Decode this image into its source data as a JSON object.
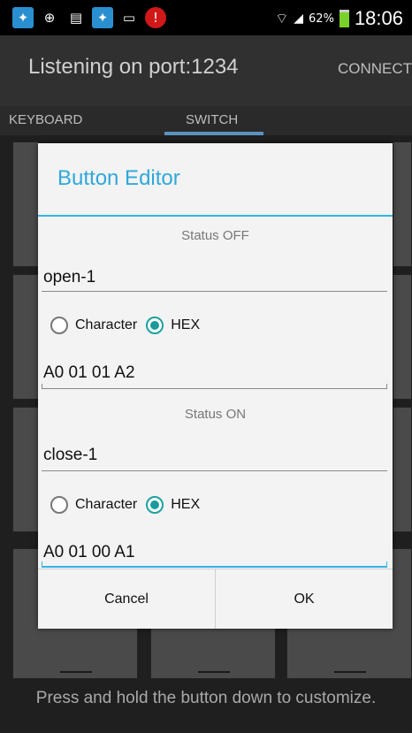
{
  "statusbar": {
    "battery_percent": "62%",
    "time": "18:06",
    "icons": [
      "app-icon",
      "signal-swap-icon",
      "list-icon",
      "app-icon",
      "image-icon",
      "alert-icon"
    ]
  },
  "actionbar": {
    "title": "Listening on port:1234",
    "connect_label": "CONNECT"
  },
  "tabs": [
    {
      "label": "KEYBOARD",
      "selected": false
    },
    {
      "label": "SWITCH",
      "selected": true
    }
  ],
  "hint": "Press and hold the button down to customize.",
  "dialog": {
    "title": "Button Editor",
    "status_off": {
      "label": "Status OFF",
      "name": "open-1",
      "option_character": "Character",
      "option_hex": "HEX",
      "selected": "HEX",
      "value": "A0 01 01 A2"
    },
    "status_on": {
      "label": "Status ON",
      "name": "close-1",
      "option_character": "Character",
      "option_hex": "HEX",
      "selected": "HEX",
      "value": "A0 01 00 A1"
    },
    "cancel_label": "Cancel",
    "ok_label": "OK"
  },
  "colors": {
    "accent": "#33b5e5",
    "radio_checked": "#1a9a9a",
    "dim_background": "#1f1f1f"
  }
}
